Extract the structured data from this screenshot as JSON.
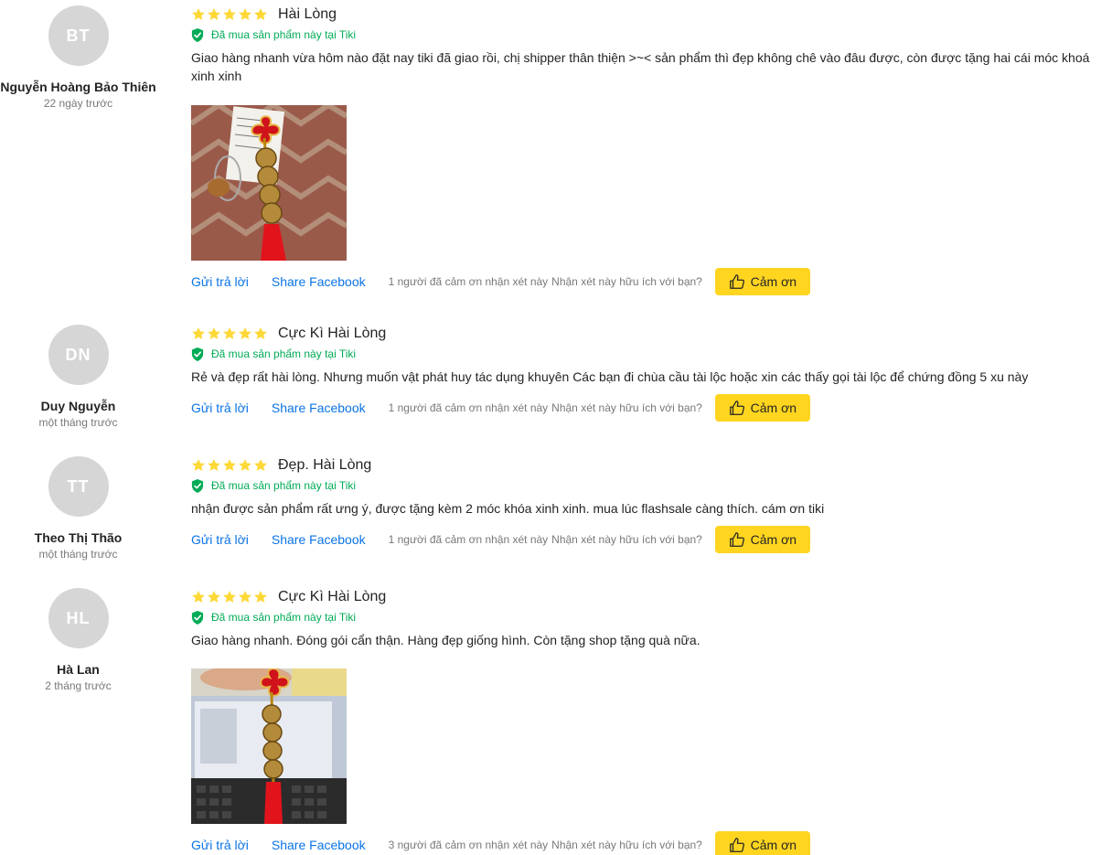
{
  "reviews": [
    {
      "initials": "BT",
      "name": "Nguyễn Hoàng Bảo Thiên",
      "time": "22 ngày trước",
      "rating": 5,
      "title": "Hài Lòng",
      "verified": "Đã mua sản phẩm này tại Tiki",
      "text": "Giao hàng nhanh vừa hôm nào đặt nay tiki đã giao rồi, chị shipper thân thiện >~< sản phẩm thì đẹp không chê vào đâu được, còn được tặng hai cái móc khoá xinh xinh",
      "has_photo": true,
      "reply": "Gửi trả lời",
      "share": "Share Facebook",
      "thanks_count": "1 người đã cảm ơn nhận xét này",
      "helpful_question": "Nhận xét này hữu ích với bạn?",
      "thanks_button": "Cảm ơn"
    },
    {
      "initials": "DN",
      "name": "Duy Nguyễn",
      "time": "một tháng trước",
      "rating": 5,
      "title": "Cực Kì Hài Lòng",
      "verified": "Đã mua sản phẩm này tại Tiki",
      "text": "Rẻ và đẹp rất hài lòng. Nhưng muốn vật phát huy tác dụng khuyên Các bạn đi chùa cầu tài lộc hoặc xin các thấy gọi tài lộc để chứng đồng 5 xu này",
      "has_photo": false,
      "reply": "Gửi trả lời",
      "share": "Share Facebook",
      "thanks_count": "1 người đã cảm ơn nhận xét này",
      "helpful_question": "Nhận xét này hữu ích với bạn?",
      "thanks_button": "Cảm ơn"
    },
    {
      "initials": "TT",
      "name": "Theo Thị Thão",
      "time": "một tháng trước",
      "rating": 5,
      "title": "Đẹp. Hài Lòng",
      "verified": "Đã mua sản phẩm này tại Tiki",
      "text": "nhận được sản phẩm rất ưng ý, được tặng kèm 2 móc khóa xinh xinh. mua lúc flashsale càng thích. cám ơn tiki",
      "has_photo": false,
      "reply": "Gửi trả lời",
      "share": "Share Facebook",
      "thanks_count": "1 người đã cảm ơn nhận xét này",
      "helpful_question": "Nhận xét này hữu ích với bạn?",
      "thanks_button": "Cảm ơn"
    },
    {
      "initials": "HL",
      "name": "Hà Lan",
      "time": "2 tháng trước",
      "rating": 5,
      "title": "Cực Kì Hài Lòng",
      "verified": "Đã mua sản phẩm này tại Tiki",
      "text": "Giao hàng nhanh. Đóng gói cẩn thận. Hàng đẹp giống hình. Còn tặng shop tặng quà nữa.",
      "has_photo": true,
      "reply": "Gửi trả lời",
      "share": "Share Facebook",
      "thanks_count": "3 người đã cảm ơn nhận xét này",
      "helpful_question": "Nhận xét này hữu ích với bạn?",
      "thanks_button": "Cảm ơn"
    }
  ],
  "colors": {
    "star": "#fdd836",
    "verified": "#00ab56",
    "link": "#0b74e5",
    "thanks_button_bg": "#ffd520",
    "avatar_bg": "#d6d6d6"
  },
  "icons": {
    "star": "star-icon",
    "verified": "shield-check-icon",
    "thanks": "thumbs-up-icon"
  }
}
